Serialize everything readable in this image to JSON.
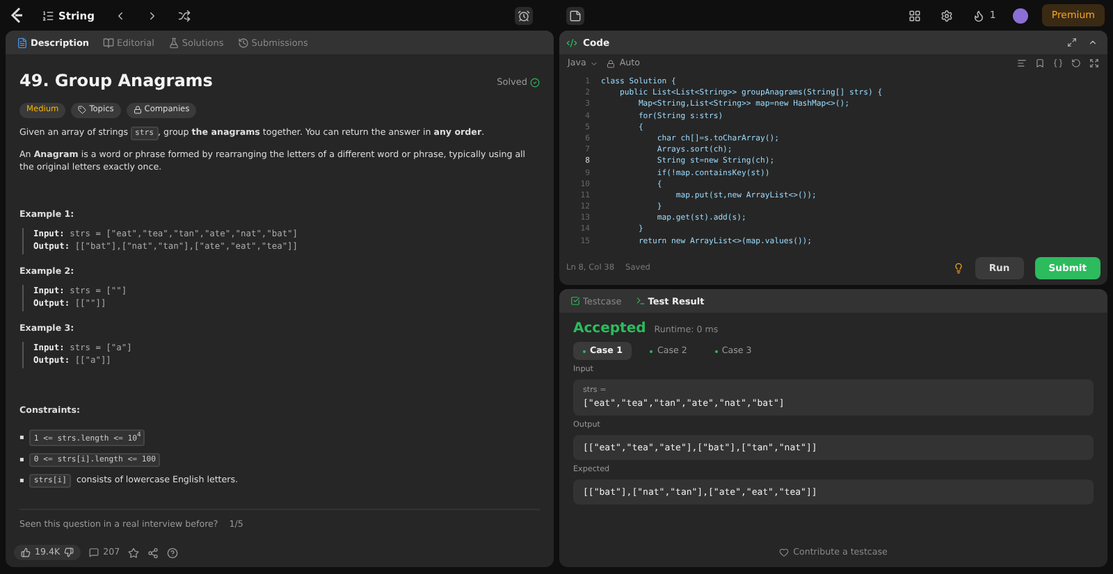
{
  "top_bar": {
    "list_name": "String",
    "premium": "Premium",
    "streak": "1"
  },
  "problem": {
    "tabs": [
      {
        "label": "Description",
        "selected": true
      },
      {
        "label": "Editorial",
        "selected": false
      },
      {
        "label": "Solutions",
        "selected": false
      },
      {
        "label": "Submissions",
        "selected": false
      }
    ],
    "title": "49. Group Anagrams",
    "status": "Solved",
    "difficulty": "Medium",
    "tags": [
      "Topics",
      "Companies"
    ],
    "paragraphs": [
      [
        {
          "kind": "text",
          "text": "Given an array of strings "
        },
        {
          "kind": "code",
          "text": "strs"
        },
        {
          "kind": "text",
          "text": ", group **the anagrams** together. You can return the answer in **any order**."
        }
      ],
      [
        {
          "kind": "text",
          "text": "An **Anagram** is a word or phrase formed by rearranging the letters of a different word or phrase, typically using all the original letters exactly once."
        }
      ]
    ],
    "examples": [
      {
        "heading": "Example 1:",
        "input_label": "Input:",
        "input": "strs = [\"eat\",\"tea\",\"tan\",\"ate\",\"nat\",\"bat\"]",
        "output_label": "Output:",
        "output": "[[\"bat\"],[\"nat\",\"tan\"],[\"ate\",\"eat\",\"tea\"]]"
      },
      {
        "heading": "Example 2:",
        "input_label": "Input:",
        "input": "strs = [\"\"]",
        "output_label": "Output:",
        "output": "[[\"\"]]"
      },
      {
        "heading": "Example 3:",
        "input_label": "Input:",
        "input": "strs = [\"a\"]",
        "output_label": "Output:",
        "output": "[[\"a\"]]"
      }
    ],
    "constraints_heading": "Constraints:",
    "constraints": [
      {
        "marker": "▪",
        "code": "1 <= strs.length <= 10$^{4}$"
      },
      {
        "marker": "▪",
        "code": "0 <= strs[i].length <= 100"
      },
      {
        "marker": "▪",
        "code": "strs[i]",
        "text": "consists of lowercase English letters."
      }
    ],
    "interview_question": "Seen this question in a real interview before?",
    "interview_page": "1/5",
    "likes": "19.4K",
    "comments": "207"
  },
  "code_panel": {
    "title": "Code",
    "language": "Java",
    "mode": "Auto",
    "lines": [
      {
        "number": "1",
        "code": "class Solution {",
        "active": false
      },
      {
        "number": "2",
        "code": "    public List<List<String>> groupAnagrams(String[] strs) {",
        "active": false
      },
      {
        "number": "3",
        "code": "        Map<String,List<String>> map=new HashMap<>();",
        "active": false
      },
      {
        "number": "4",
        "code": "        for(String s:strs)",
        "active": false
      },
      {
        "number": "5",
        "code": "        {",
        "active": false
      },
      {
        "number": "6",
        "code": "            char ch[]=s.toCharArray();",
        "active": false
      },
      {
        "number": "7",
        "code": "            Arrays.sort(ch);",
        "active": false
      },
      {
        "number": "8",
        "code": "            String st=new String(ch);",
        "active": true
      },
      {
        "number": "9",
        "code": "            if(!map.containsKey(st))",
        "active": false
      },
      {
        "number": "10",
        "code": "            {",
        "active": false
      },
      {
        "number": "11",
        "code": "                map.put(st,new ArrayList<>());",
        "active": false
      },
      {
        "number": "12",
        "code": "            }",
        "active": false
      },
      {
        "number": "13",
        "code": "            map.get(st).add(s);",
        "active": false
      },
      {
        "number": "14",
        "code": "        }",
        "active": false
      },
      {
        "number": "15",
        "code": "        return new ArrayList<>(map.values());",
        "active": false
      }
    ],
    "cursor": "Ln 8, Col 38",
    "save_state": "Saved",
    "run": "Run",
    "submit": "Submit"
  },
  "result_panel": {
    "tabs": [
      {
        "label": "Testcase",
        "selected": false
      },
      {
        "label": "Test Result",
        "selected": true
      }
    ],
    "verdict": "Accepted",
    "runtime": "Runtime: 0 ms",
    "cases": [
      {
        "label": "Case 1",
        "selected": true
      },
      {
        "label": "Case 2",
        "selected": false
      },
      {
        "label": "Case 3",
        "selected": false
      }
    ],
    "input_label": "Input",
    "param": "strs =",
    "input": "[\"eat\",\"tea\",\"tan\",\"ate\",\"nat\",\"bat\"]",
    "output_label": "Output",
    "output": "[[\"eat\",\"tea\",\"ate\"],[\"bat\"],[\"tan\",\"nat\"]]",
    "expected_label": "Expected",
    "expected": "[[\"bat\"],[\"nat\",\"tan\"],[\"ate\",\"eat\",\"tea\"]]",
    "contribute": "Contribute a testcase"
  }
}
